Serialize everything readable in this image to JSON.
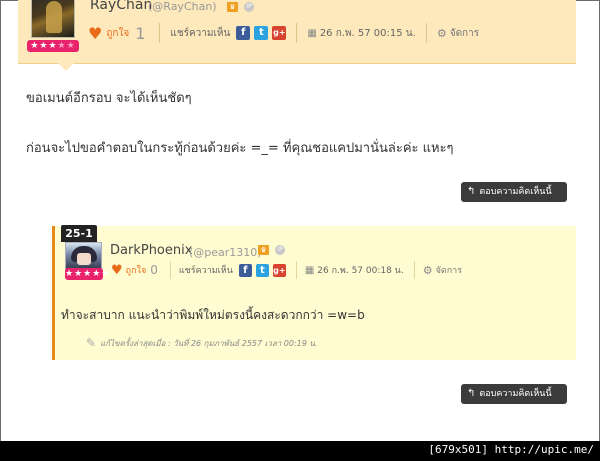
{
  "main_comment": {
    "username": "RayChan",
    "handle": "(@RayChan)",
    "crown_icon": "crown-icon",
    "ip_icon": "ip-icon",
    "like_label": "ถูกใจ",
    "like_count": "1",
    "share_label": "แชร์ความเห็น",
    "date": "26 ก.พ. 57 00:15 น.",
    "manage_label": "จัดการ",
    "stars": "★★★★★",
    "lines": [
      "ขอเมนต์อีกรอบ จะได้เห็นชัดๆ",
      "ก่อนจะไปขอคำตอบในกระทู้ก่อนด้วยค่ะ =_= ที่คุณชอแคปมานั่นล่ะค่ะ แหะๆ"
    ],
    "reply_button": "ตอบความคิดเห็นนี้"
  },
  "reply": {
    "number": "25-1",
    "username": "DarkPhoenix",
    "handle": "(@pear1310)",
    "like_label": "ถูกใจ",
    "like_count": "0",
    "share_label": "แชร์ความเห็น",
    "date": "26 ก.พ. 57 00:18 น.",
    "manage_label": "จัดการ",
    "stars": "★★★★★",
    "text": "ทำจะสาบาก แนะนำว่าพิมพ์ใหม่ตรงนี้คงสะดวกกว่า =w=b",
    "edited_note": "แก้ไขครั้งล่าสุดเมื่อ : วันที่ 26 กุมภาพันธ์ 2557 เวลา 00:19 น."
  },
  "bottom_reply_button": "ตอบความคิดเห็นนี้",
  "status_strip": "[679x501] http://upic.me/",
  "colors": {
    "header_bg": "#fde9bb",
    "reply_bg": "#fefcd0",
    "accent_orange": "#e88a1a",
    "star_pink": "#e8236b",
    "facebook": "#3b5b99",
    "twitter": "#2aa3e0",
    "google_plus": "#d7432f"
  }
}
